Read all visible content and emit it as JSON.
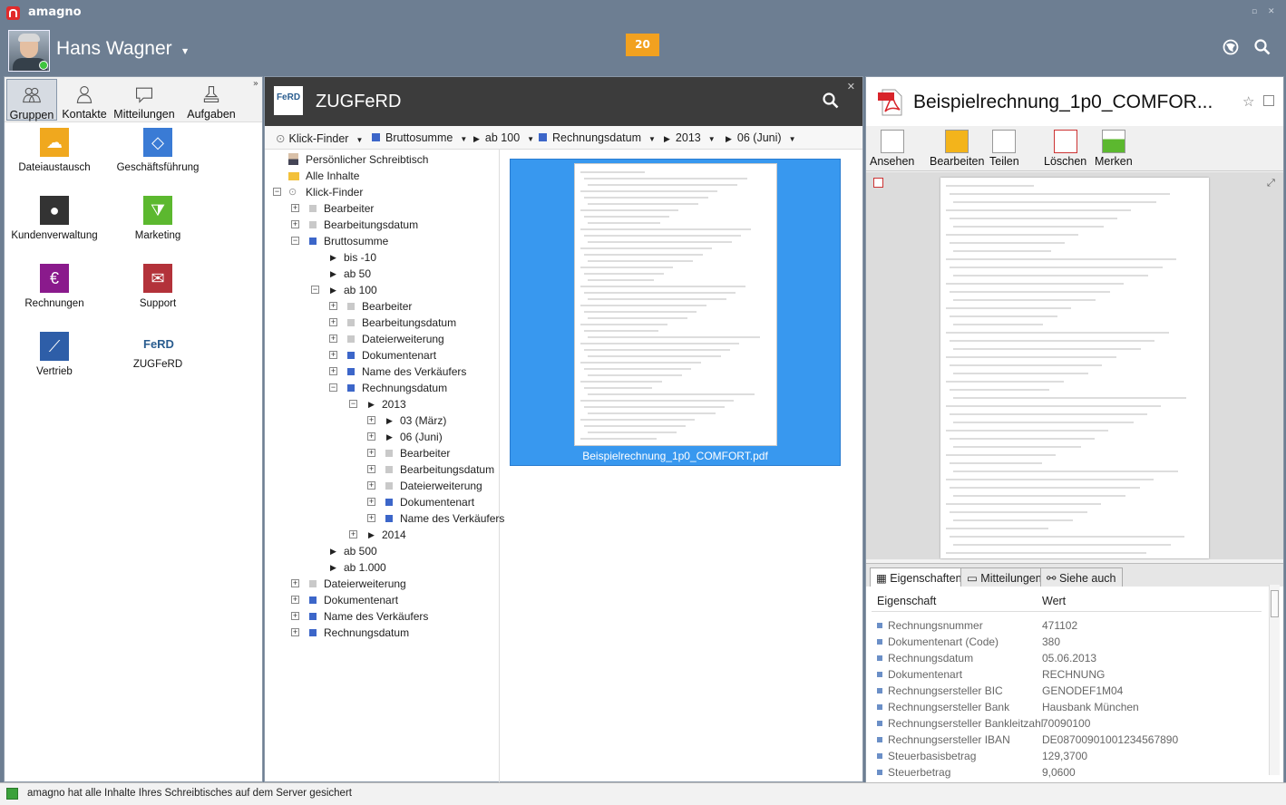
{
  "app": {
    "name": "amagno"
  },
  "user": {
    "name": "Hans Wagner"
  },
  "notification_count": "20",
  "nav": {
    "tabs": [
      {
        "label": "Gruppen"
      },
      {
        "label": "Kontakte"
      },
      {
        "label": "Mitteilungen"
      },
      {
        "label": "Aufgaben"
      }
    ]
  },
  "groups": [
    {
      "label": "Dateiaustausch",
      "icon": "cloud-icon",
      "color": "#f0a81e"
    },
    {
      "label": "Geschäftsführung",
      "icon": "diamond-icon",
      "color": "#3a7bd5"
    },
    {
      "label": "Kundenverwaltung",
      "icon": "person-icon",
      "color": "#333333"
    },
    {
      "label": "Marketing",
      "icon": "marketing-icon",
      "color": "#5cb82f"
    },
    {
      "label": "Rechnungen",
      "icon": "euro-icon",
      "color": "#8a1a8c"
    },
    {
      "label": "Support",
      "icon": "mail-icon",
      "color": "#b3323a"
    },
    {
      "label": "Vertrieb",
      "icon": "chart-icon",
      "color": "#2e5ea8"
    },
    {
      "label": "ZUGFeRD",
      "icon": "ferd-icon",
      "color": "#2a5d8f"
    }
  ],
  "mid": {
    "title": "ZUGFeRD",
    "logo_text": "FeRD"
  },
  "crumbs": [
    "Klick-Finder",
    "Bruttosumme",
    "ab 100",
    "Rechnungsdatum",
    "2013",
    "06 (Juni)"
  ],
  "tree": [
    {
      "label": "Persönlicher Schreibtisch"
    },
    {
      "label": "Alle Inhalte"
    },
    {
      "label": "Klick-Finder"
    },
    {
      "label": "Bearbeiter"
    },
    {
      "label": "Bearbeitungsdatum"
    },
    {
      "label": "Bruttosumme"
    },
    {
      "label": "bis -10"
    },
    {
      "label": "ab 50"
    },
    {
      "label": "ab 100"
    },
    {
      "label": "Bearbeiter"
    },
    {
      "label": "Bearbeitungsdatum"
    },
    {
      "label": "Dateierweiterung"
    },
    {
      "label": "Dokumentenart"
    },
    {
      "label": "Name des Verkäufers"
    },
    {
      "label": "Rechnungsdatum"
    },
    {
      "label": "2013"
    },
    {
      "label": "03 (März)"
    },
    {
      "label": "06 (Juni)"
    },
    {
      "label": "Bearbeiter"
    },
    {
      "label": "Bearbeitungsdatum"
    },
    {
      "label": "Dateierweiterung"
    },
    {
      "label": "Dokumentenart"
    },
    {
      "label": "Name des Verkäufers"
    },
    {
      "label": "2014"
    },
    {
      "label": "ab 500"
    },
    {
      "label": "ab 1.000"
    },
    {
      "label": "Dateierweiterung"
    },
    {
      "label": "Dokumentenart"
    },
    {
      "label": "Name des Verkäufers"
    },
    {
      "label": "Rechnungsdatum"
    }
  ],
  "preview": {
    "filename": "Beispielrechnung_1p0_COMFORT.pdf"
  },
  "right": {
    "title": "Beispielrechnung_1p0_COMFOR...",
    "pdf_label": "PDF"
  },
  "toolbar": [
    {
      "label": "Ansehen"
    },
    {
      "label": "Bearbeiten"
    },
    {
      "label": "Teilen"
    },
    {
      "label": "Löschen"
    },
    {
      "label": "Merken"
    }
  ],
  "prop_tabs": [
    {
      "label": "Eigenschaften"
    },
    {
      "label": "Mitteilungen"
    },
    {
      "label": "Siehe auch"
    }
  ],
  "prop_headers": {
    "key": "Eigenschaft",
    "value": "Wert"
  },
  "properties": [
    {
      "k": "Rechnungsnummer",
      "v": "471102"
    },
    {
      "k": "Dokumentenart (Code)",
      "v": "380"
    },
    {
      "k": "Rechnungsdatum",
      "v": "05.06.2013"
    },
    {
      "k": "Dokumentenart",
      "v": "RECHNUNG"
    },
    {
      "k": "Rechnungsersteller BIC",
      "v": "GENODEF1M04"
    },
    {
      "k": "Rechnungsersteller Bank",
      "v": "Hausbank München"
    },
    {
      "k": "Rechnungsersteller Bankleitzahl",
      "v": "70090100"
    },
    {
      "k": "Rechnungsersteller IBAN",
      "v": "DE08700901001234567890"
    },
    {
      "k": "Steuerbasisbetrag",
      "v": "129,3700"
    },
    {
      "k": "Steuerbetrag",
      "v": "9,0600"
    }
  ],
  "status": {
    "text": "amagno hat alle Inhalte Ihres Schreibtisches auf dem Server gesichert"
  }
}
